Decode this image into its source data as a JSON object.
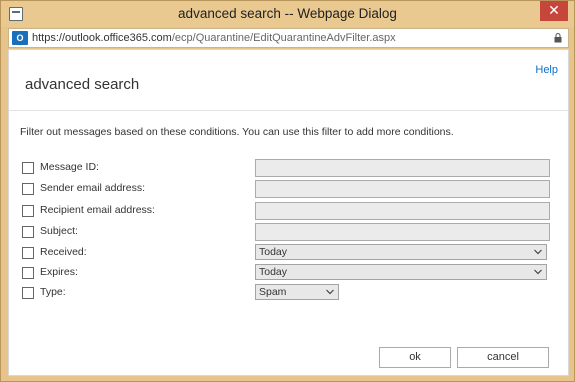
{
  "window": {
    "title": "advanced search -- Webpage Dialog",
    "close_label": "✕"
  },
  "address": {
    "outlook_icon": "O",
    "url_prefix": "https://outlook.",
    "url_domain": "office365.com",
    "url_path": "/ecp/Quarantine/EditQuarantineAdvFilter.aspx",
    "lock_icon": "lock-icon"
  },
  "dialog": {
    "help_label": "Help",
    "title": "advanced search",
    "instructions": "Filter out messages based on these conditions. You can use this filter to add more conditions."
  },
  "fields": {
    "message_id": {
      "label": "Message ID:",
      "value": ""
    },
    "sender": {
      "label": "Sender email address:",
      "value": ""
    },
    "recipient": {
      "label": "Recipient email address:",
      "value": ""
    },
    "subject": {
      "label": "Subject:",
      "value": ""
    },
    "received": {
      "label": "Received:",
      "value": "Today"
    },
    "expires": {
      "label": "Expires:",
      "value": "Today"
    },
    "type": {
      "label": "Type:",
      "value": "Spam"
    }
  },
  "buttons": {
    "ok": "ok",
    "cancel": "cancel"
  }
}
